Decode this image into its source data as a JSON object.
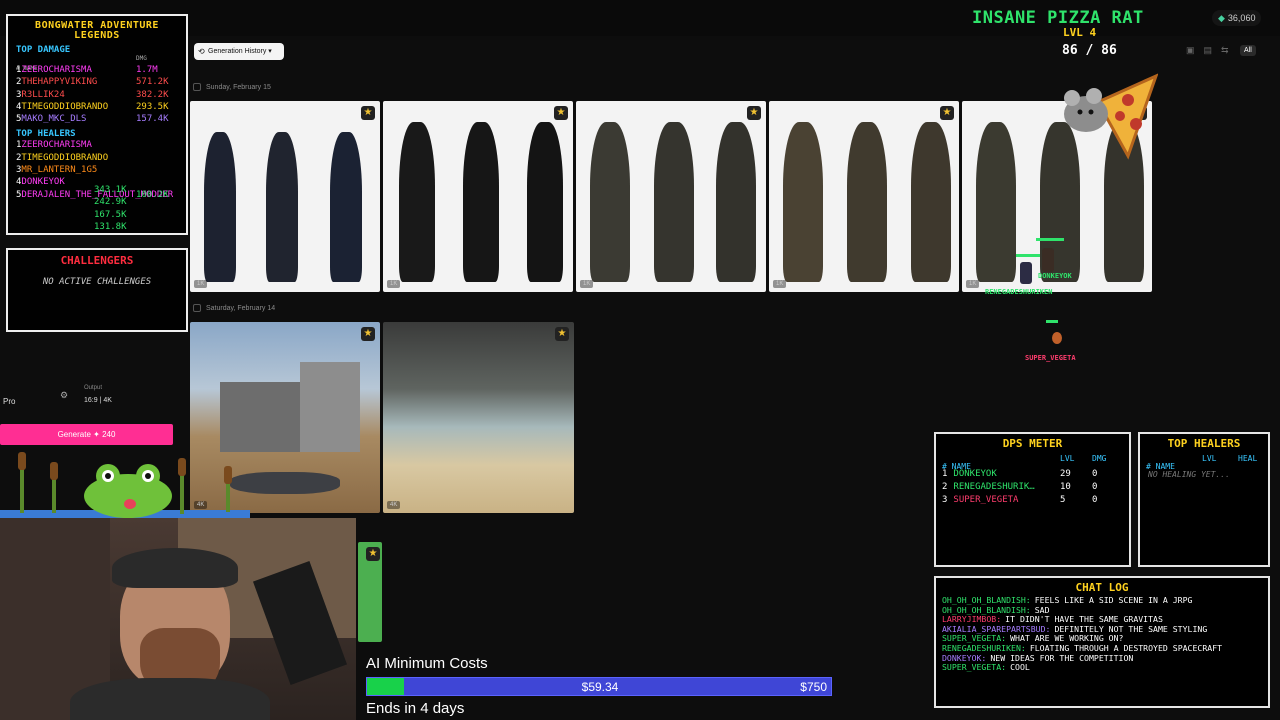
{
  "header": {
    "credits": "36,060"
  },
  "gallery": {
    "history_button": "Generation History",
    "view_all": "All",
    "groups": [
      {
        "date": "Sunday, February 15",
        "items": [
          {
            "res": "1K",
            "starred": true
          },
          {
            "res": "1K",
            "starred": true
          },
          {
            "res": "1K",
            "starred": true
          },
          {
            "res": "1K",
            "starred": true
          },
          {
            "res": "1K",
            "starred": true
          }
        ]
      },
      {
        "date": "Saturday, February 14",
        "items": [
          {
            "res": "4K",
            "starred": true
          },
          {
            "res": "4K",
            "starred": true
          }
        ]
      }
    ]
  },
  "controls": {
    "model": "Pro",
    "output_label": "Output",
    "output_value": "16:9 | 4K",
    "generate_label": "Generate",
    "generate_cost": "✦ 240"
  },
  "leaderboard": {
    "title_line1": "BONGWATER ADVENTURE",
    "title_line2": "LEGENDS",
    "damage_title": "TOP DAMAGE",
    "col_name": "# NAME",
    "col_dmg": "DMG",
    "damage_rows": [
      {
        "rank": "1",
        "name": "ZEEROCHARISMA",
        "value": "1.7M",
        "color": "#ff3df5"
      },
      {
        "rank": "2",
        "name": "THEHAPPYVIKING",
        "value": "571.2K",
        "color": "#ff4d4d"
      },
      {
        "rank": "3",
        "name": "R3LLIK24",
        "value": "382.2K",
        "color": "#ff4d4d"
      },
      {
        "rank": "4",
        "name": "TIMEGODDIOBRANDO",
        "value": "293.5K",
        "color": "#ffd21f"
      },
      {
        "rank": "5",
        "name": "MAKO_MKC_DLS",
        "value": "157.4K",
        "color": "#a67dff"
      }
    ],
    "healers_title": "TOP HEALERS",
    "healer_rows": [
      {
        "rank": "1",
        "name": "ZEEROCHARISMA",
        "value": "",
        "color": "#ff3df5"
      },
      {
        "rank": "2",
        "name": "TIMEGODDIOBRANDO",
        "value": "",
        "color": "#ffd21f"
      },
      {
        "rank": "3",
        "name": "MR_LANTERN_1G5",
        "value": "",
        "color": "#ff8c1a"
      },
      {
        "rank": "4",
        "name": "DONKEYOK",
        "value": "",
        "color": "#ff3df5"
      },
      {
        "rank": "5",
        "name": "DERAJALEN_THE_FALLOUT_MODDER",
        "value": "100.2K",
        "color": "#ff3df5"
      }
    ],
    "heal_values": [
      "343.1K",
      "242.9K",
      "167.5K",
      "131.8K"
    ]
  },
  "challenges": {
    "title": "CHALLENGERS",
    "empty": "NO ACTIVE CHALLENGES"
  },
  "boss": {
    "name": "INSANE PIZZA RAT",
    "level": "LVL 4",
    "hp": "86 / 86"
  },
  "dps_meter": {
    "title": "DPS METER",
    "col_name": "# NAME",
    "col_lvl": "LVL",
    "col_dmg": "DMG",
    "rows": [
      {
        "rank": "1",
        "name": "DONKEYOK",
        "lvl": "29",
        "dmg": "0",
        "color": "#2fe36b"
      },
      {
        "rank": "2",
        "name": "RENEGADESHURIK…",
        "lvl": "10",
        "dmg": "0",
        "color": "#2fe36b"
      },
      {
        "rank": "3",
        "name": "SUPER_VEGETA",
        "lvl": "5",
        "dmg": "0",
        "color": "#ff3d6e"
      }
    ]
  },
  "top_healers": {
    "title": "TOP HEALERS",
    "col_name": "# NAME",
    "col_lvl": "LVL",
    "col_heal": "HEAL",
    "empty": "NO HEALING YET..."
  },
  "players": {
    "p1": "DONKEYOK",
    "p2": "RENEGADESHURIKEN",
    "p3": "SUPER_VEGETA"
  },
  "chat": {
    "title": "CHAT LOG",
    "lines": [
      {
        "user": "OH_OH_OH_BLANDISH:",
        "text": "FEELS LIKE A SID SCENE IN A JRPG",
        "color": "#2fe36b"
      },
      {
        "user": "OH_OH_OH_BLANDISH:",
        "text": "SAD",
        "color": "#2fe36b"
      },
      {
        "user": "LARRYJIMBOB:",
        "text": "IT DIDN'T HAVE THE SAME GRAVITAS",
        "color": "#ff3d6e"
      },
      {
        "user": "AKIALIA_SPAREPARTSBUD:",
        "text": "DEFINITELY NOT THE SAME STYLING",
        "color": "#a67dff"
      },
      {
        "user": "SUPER_VEGETA:",
        "text": "WHAT ARE WE WORKING ON?",
        "color": "#2fe36b"
      },
      {
        "user": "RENEGADESHURIKEN:",
        "text": "FLOATING THROUGH A DESTROYED SPACECRAFT",
        "color": "#2fe36b"
      },
      {
        "user": "DONKEYOK:",
        "text": "NEW IDEAS FOR THE COMPETITION",
        "color": "#a67dff"
      },
      {
        "user": "SUPER_VEGETA:",
        "text": "COOL",
        "color": "#2fe36b"
      }
    ]
  },
  "goal": {
    "title": "AI Minimum Costs",
    "current": "$59.34",
    "target": "$750",
    "progress": 0.079,
    "ends": "Ends in 4 days"
  }
}
